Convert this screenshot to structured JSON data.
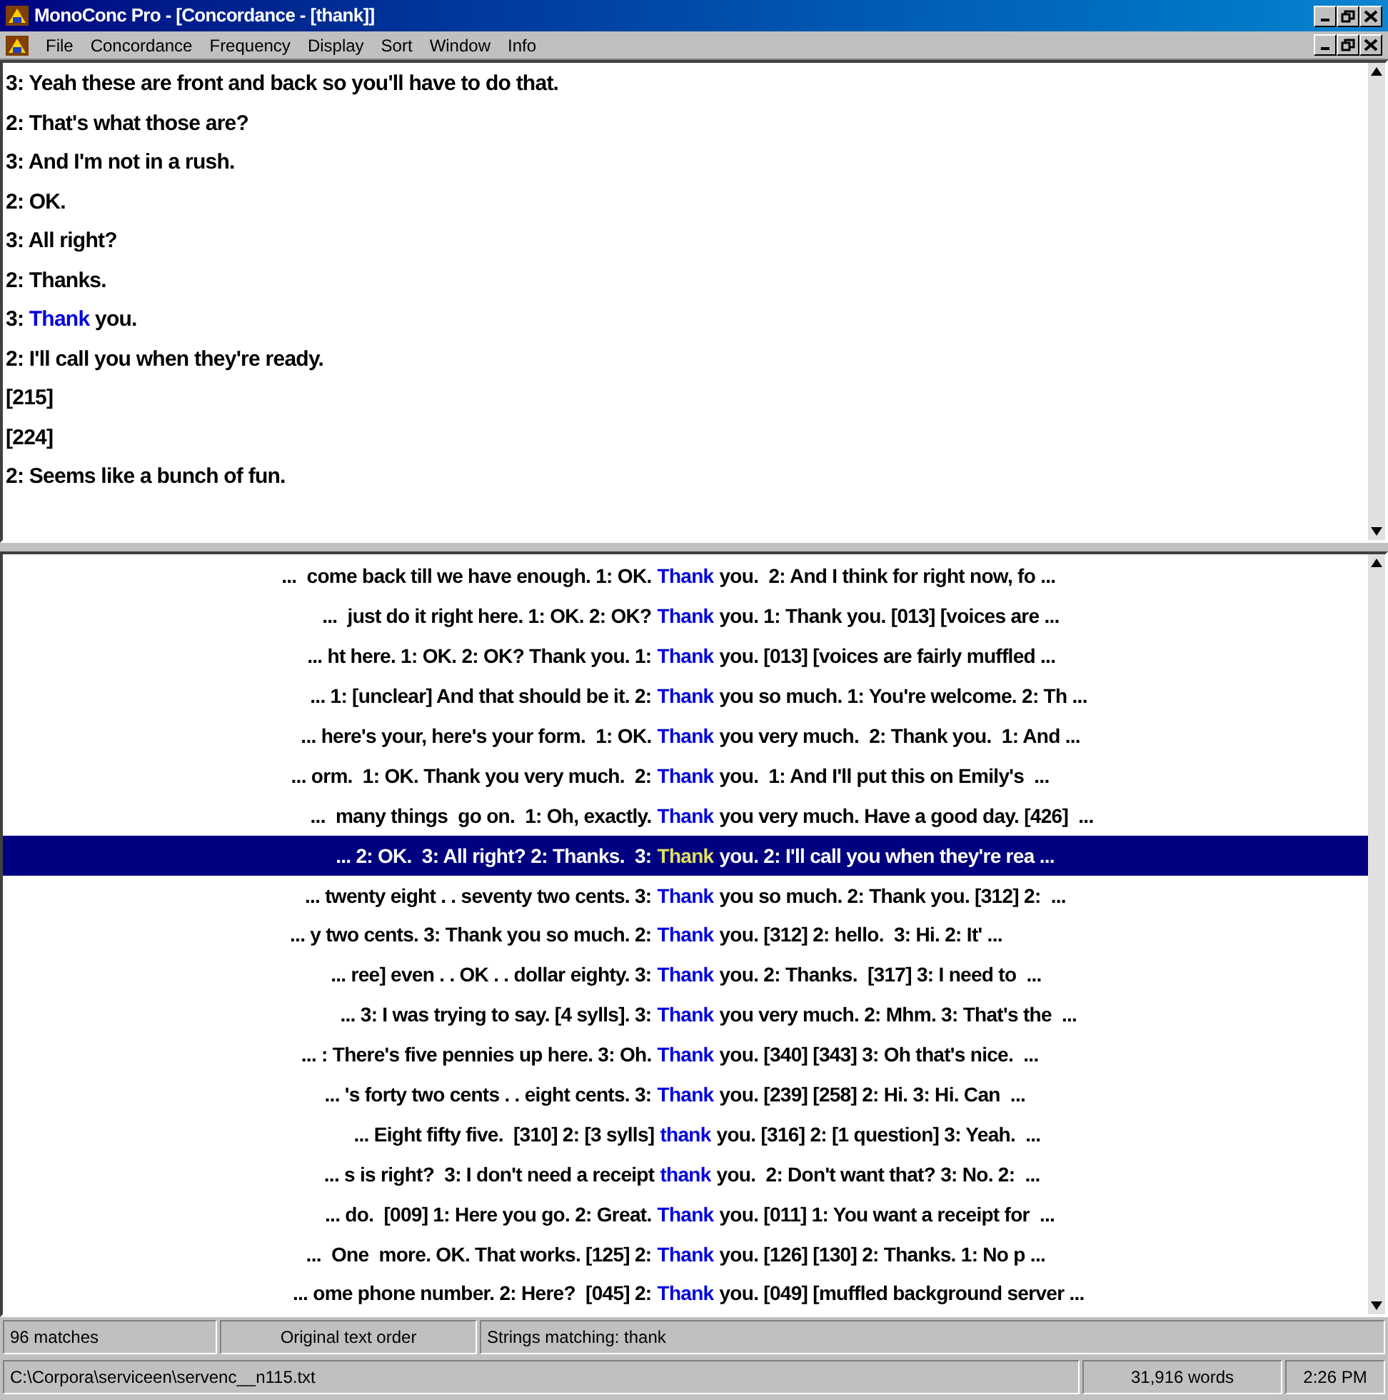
{
  "window": {
    "title": "MonoConc Pro - [Concordance - [thank]]"
  },
  "menu": [
    "File",
    "Concordance",
    "Frequency",
    "Display",
    "Sort",
    "Window",
    "Info"
  ],
  "context_pane": {
    "lines": [
      {
        "kind": "plain",
        "text": "3: Yeah these are front and back so you'll have to do that."
      },
      {
        "kind": "plain",
        "text": "2: That's what those are?"
      },
      {
        "kind": "plain",
        "text": "3: And I'm not in a rush."
      },
      {
        "kind": "plain",
        "text": "2: OK."
      },
      {
        "kind": "plain",
        "text": "3: All right?"
      },
      {
        "kind": "plain",
        "text": "2: Thanks."
      },
      {
        "kind": "match",
        "before": "3: ",
        "match": "Thank",
        "after": " you."
      },
      {
        "kind": "plain",
        "text": "2: I'll call you when they're ready."
      },
      {
        "kind": "plain",
        "text": "[215]"
      },
      {
        "kind": "plain",
        "text": "[224]"
      },
      {
        "kind": "plain",
        "text": "2: Seems like a bunch of fun."
      }
    ]
  },
  "concordance": [
    {
      "left": "...  come back till we have enough. 1: OK.",
      "match": "Thank",
      "right": "you.  2: And I think for right now, fo ...",
      "selected": false
    },
    {
      "left": "...  just do it right here. 1: OK. 2: OK?",
      "match": "Thank",
      "right": "you. 1: Thank you. [013] [voices are ...",
      "selected": false
    },
    {
      "left": "... ht here. 1: OK. 2: OK? Thank you. 1:",
      "match": "Thank",
      "right": "you. [013] [voices are fairly muffled ...",
      "selected": false
    },
    {
      "left": "... 1: [unclear] And that should be it. 2:",
      "match": "Thank",
      "right": "you so much. 1: You're welcome. 2: Th ...",
      "selected": false
    },
    {
      "left": "... here's your, here's your form.  1: OK.",
      "match": "Thank",
      "right": "you very much.  2: Thank you.  1: And ...",
      "selected": false
    },
    {
      "left": "... orm.  1: OK. Thank you very much.  2:",
      "match": "Thank",
      "right": "you.  1: And I'll put this on Emily's  ...",
      "selected": false
    },
    {
      "left": "...  many things  go on.  1: Oh, exactly.",
      "match": "Thank",
      "right": "you very much. Have a good day. [426]  ...",
      "selected": false
    },
    {
      "left": "... 2: OK.  3: All right? 2: Thanks.  3:",
      "match": "Thank",
      "right": "you. 2: I'll call you when they're rea ...",
      "selected": true
    },
    {
      "left": "... twenty eight . . seventy two cents. 3:",
      "match": "Thank",
      "right": "you so much. 2: Thank you. [312] 2:  ...",
      "selected": false
    },
    {
      "left": "... y two cents. 3: Thank you so much. 2:",
      "match": "Thank",
      "right": "you. [312] 2: hello.  3: Hi. 2: It' ...",
      "selected": false
    },
    {
      "left": "... ree] even . . OK . . dollar eighty. 3:",
      "match": "Thank",
      "right": "you. 2: Thanks.  [317] 3: I need to  ...",
      "selected": false
    },
    {
      "left": "... 3: I was trying to say. [4 sylls]. 3:",
      "match": "Thank",
      "right": "you very much. 2: Mhm. 3: That's the  ...",
      "selected": false
    },
    {
      "left": "... : There's five pennies up here. 3: Oh.",
      "match": "Thank",
      "right": "you. [340] [343] 3: Oh that's nice.  ...",
      "selected": false
    },
    {
      "left": "... 's forty two cents . . eight cents. 3:",
      "match": "Thank",
      "right": "you. [239] [258] 2: Hi. 3: Hi. Can  ...",
      "selected": false
    },
    {
      "left": "... Eight fifty five.  [310] 2: [3 sylls]",
      "match": "thank",
      "right": "you. [316] 2: [1 question] 3: Yeah.  ...",
      "selected": false
    },
    {
      "left": "... s is right?  3: I don't need a receipt",
      "match": "thank",
      "right": "you.  2: Don't want that? 3: No. 2:  ...",
      "selected": false
    },
    {
      "left": "... do.  [009] 1: Here you go. 2: Great.",
      "match": "Thank",
      "right": "you. [011] 1: You want a receipt for  ...",
      "selected": false
    },
    {
      "left": "...  One  more. OK. That works. [125] 2:",
      "match": "Thank",
      "right": "you. [126] [130] 2: Thanks. 1: No p ...",
      "selected": false
    },
    {
      "left": "... ome phone number. 2: Here?  [045] 2:",
      "match": "Thank",
      "right": "you. [049] [muffled background server ...",
      "selected": false
    }
  ],
  "status_bar": {
    "matches": "96 matches",
    "order": "Original text order",
    "search": "Strings matching: thank"
  },
  "file_bar": {
    "path": "C:\\Corpora\\serviceen\\servenc__n115.txt",
    "words": "31,916 words",
    "time": "2:26 PM"
  }
}
